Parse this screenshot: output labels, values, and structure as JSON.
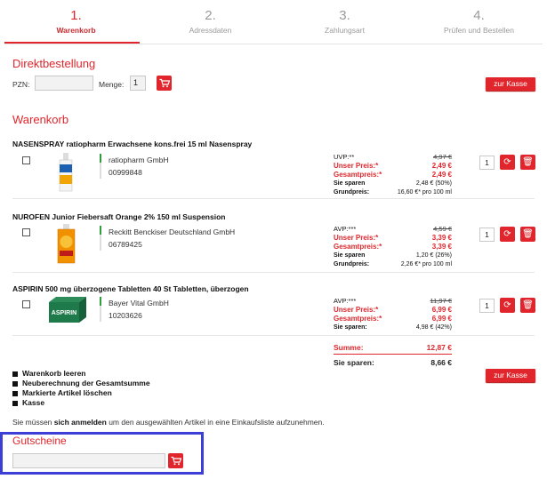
{
  "steps": [
    {
      "num": "1.",
      "label": "Warenkorb"
    },
    {
      "num": "2.",
      "label": "Adressdaten"
    },
    {
      "num": "3.",
      "label": "Zahlungsart"
    },
    {
      "num": "4.",
      "label": "Prüfen und Bestellen"
    }
  ],
  "direct": {
    "title": "Direktbestellung",
    "pzn_label": "PZN:",
    "pzn_value": "",
    "menge_label": "Menge:",
    "menge_value": "1",
    "kasse": "zur Kasse"
  },
  "cart": {
    "title": "Warenkorb",
    "items": [
      {
        "title": "NASENSPRAY ratiopharm Erwachsene kons.frei 15 ml Nasenspray",
        "vendor": "ratiopharm GmbH",
        "pzn": "00999848",
        "p1_label": "UVP:**",
        "p1": "4,97 €",
        "p2_label": "Unser Preis:*",
        "p2": "2,49 €",
        "p3_label": "Gesamtpreis:*",
        "p3": "2,49 €",
        "p4_label": "Sie sparen",
        "p4": "2,48 € (50%)",
        "p5_label": "Grundpreis:",
        "p5": "16,60 €* pro 100 ml",
        "qty": "1"
      },
      {
        "title": "NUROFEN Junior Fiebersaft Orange 2% 150 ml Suspension",
        "vendor": "Reckitt Benckiser Deutschland GmbH",
        "pzn": "06789425",
        "p1_label": "AVP:***",
        "p1": "4,59 €",
        "p2_label": "Unser Preis:*",
        "p2": "3,39 €",
        "p3_label": "Gesamtpreis:*",
        "p3": "3,39 €",
        "p4_label": "Sie sparen",
        "p4": "1,20 € (26%)",
        "p5_label": "Grundpreis:",
        "p5": "2,26 €* pro 100 ml",
        "qty": "1"
      },
      {
        "title": "ASPIRIN 500 mg überzogene Tabletten 40 St Tabletten, überzogen",
        "vendor": "Bayer Vital GmbH",
        "pzn": "10203626",
        "p1_label": "AVP:***",
        "p1": "11,97 €",
        "p2_label": "Unser Preis:*",
        "p2": "6,99 €",
        "p3_label": "Gesamtpreis:*",
        "p3": "6,99 €",
        "p4_label": "Sie sparen:",
        "p4": "4,98 € (42%)",
        "qty": "1",
        "box_label": "ASPIRIN"
      }
    ],
    "summe_label": "Summe:",
    "summe": "12,87 €",
    "sparen_label": "Sie sparen:",
    "sparen": "8,66 €",
    "kasse": "zur Kasse"
  },
  "actions": [
    "Warenkorb leeren",
    "Neuberechnung der Gesamtsumme",
    "Markierte Artikel löschen",
    "Kasse"
  ],
  "note": {
    "pre": "Sie müssen ",
    "link": "sich anmelden",
    "post": " um den ausgewählten Artikel in eine Einkaufsliste aufzunehmen."
  },
  "gutscheine": {
    "title": "Gutscheine",
    "value": ""
  },
  "colors": {
    "accent": "#e0262c",
    "highlight_border": "#3b3fd6",
    "vendor_marker": "#2e9f3a"
  }
}
